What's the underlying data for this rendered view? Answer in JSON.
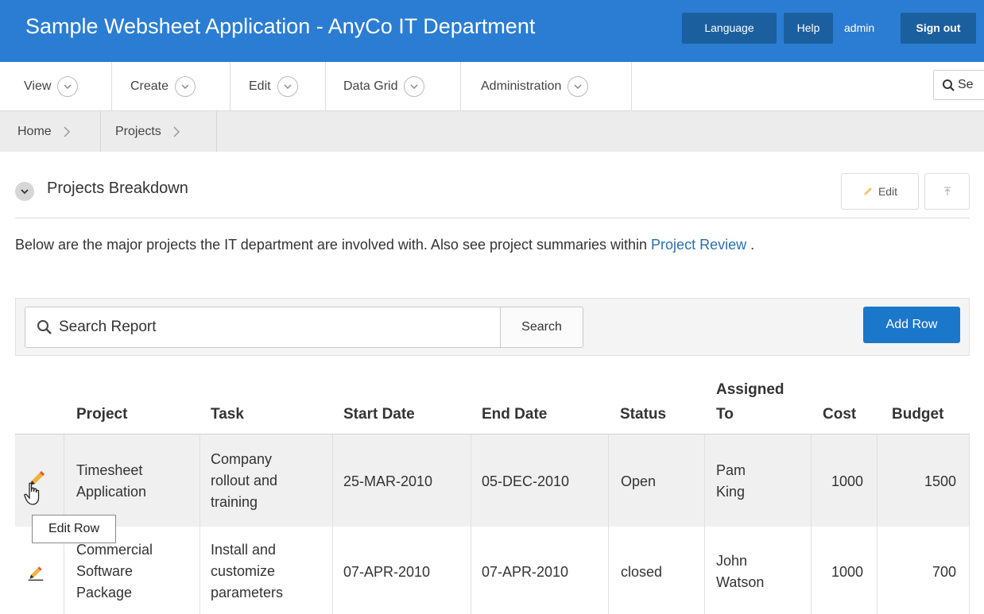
{
  "header": {
    "title": "Sample Websheet Application - AnyCo IT Department",
    "language_label": "Language",
    "help_label": "Help",
    "user_label": "admin",
    "signout_label": "Sign out",
    "accent": "#2a7dd3"
  },
  "menu": {
    "items": [
      {
        "label": "View"
      },
      {
        "label": "Create"
      },
      {
        "label": "Edit"
      },
      {
        "label": "Data Grid"
      },
      {
        "label": "Administration"
      }
    ],
    "search_partial": "Se"
  },
  "breadcrumb": {
    "items": [
      {
        "label": "Home"
      },
      {
        "label": "Projects"
      }
    ]
  },
  "region": {
    "title": "Projects Breakdown",
    "edit_label": "Edit",
    "description": "Below are the major projects the IT department are involved with. Also see project summaries within ",
    "link_label": "Project Review",
    "description_end": " ."
  },
  "toolbar": {
    "search_placeholder": "Search Report",
    "search_button": "Search",
    "add_row_button": "Add Row",
    "add_row_color": "#1a77c9"
  },
  "table": {
    "columns": [
      "Project",
      "Task",
      "Start Date",
      "End Date",
      "Status",
      "Assigned To",
      "Cost",
      "Budget"
    ],
    "rows": [
      {
        "project": [
          "Timesheet",
          "Application"
        ],
        "task": [
          "Company",
          "rollout and",
          "training"
        ],
        "start_date": "25-MAR-2010",
        "end_date": "05-DEC-2010",
        "status": "Open",
        "assigned_to": [
          "Pam",
          "King"
        ],
        "cost": "1000",
        "budget": "1500"
      },
      {
        "project": [
          "Commercial",
          "Software",
          "Package"
        ],
        "task": [
          "Install and",
          "customize",
          "parameters"
        ],
        "start_date": "07-APR-2010",
        "end_date": "07-APR-2010",
        "status": "closed",
        "assigned_to": [
          "John",
          "Watson"
        ],
        "cost": "1000",
        "budget": "700"
      }
    ]
  },
  "tooltip": {
    "text": "Edit Row"
  },
  "icons": {
    "menu_toggle": "chevron-down-icon",
    "breadcrumb_sep": "chevron-right-icon",
    "search": "search-icon",
    "edit_row": "pencil-icon",
    "region_collapse": "chevron-down-icon",
    "scroll_top": "arrow-up-to-top-icon"
  }
}
